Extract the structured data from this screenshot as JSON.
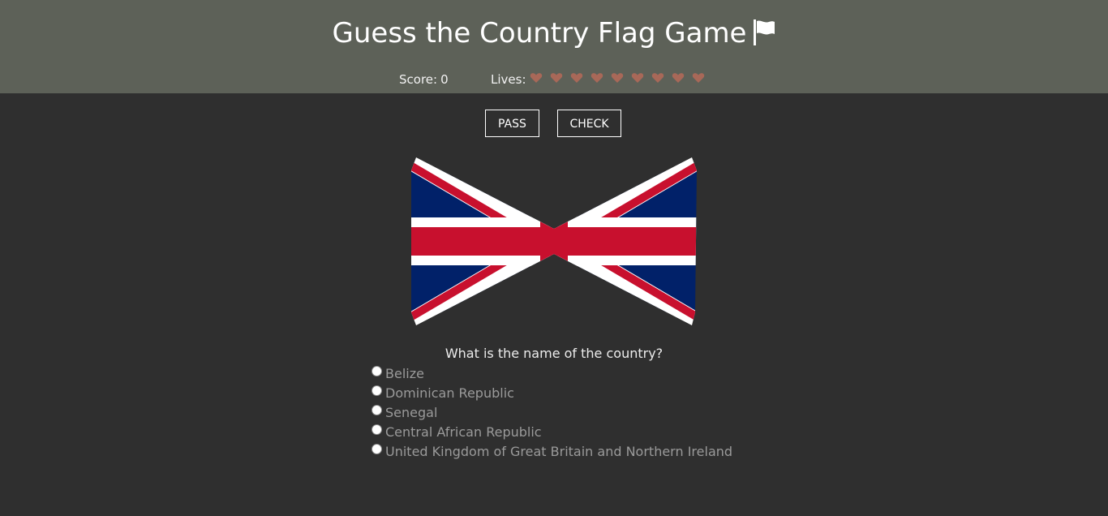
{
  "header": {
    "title": "Guess the Country Flag Game",
    "title_icon": "flag-icon",
    "score_label": "Score:",
    "score_value": "0",
    "lives_label": "Lives:",
    "lives_count": 9,
    "heart_color": "#a86858",
    "background": "#5d6158"
  },
  "actions": {
    "pass_label": "PASS",
    "check_label": "CHECK"
  },
  "flag": {
    "icon": "union-jack-flag",
    "colors": {
      "blue": "#012169",
      "red": "#c8102e",
      "white": "#ffffff"
    }
  },
  "quiz": {
    "question": "What is the name of the country?",
    "options": [
      "Belize",
      "Dominican Republic",
      "Senegal",
      "Central African Republic",
      "United Kingdom of Great Britain and Northern Ireland"
    ],
    "selected": null
  },
  "theme": {
    "page_background": "#2f2f2f"
  }
}
